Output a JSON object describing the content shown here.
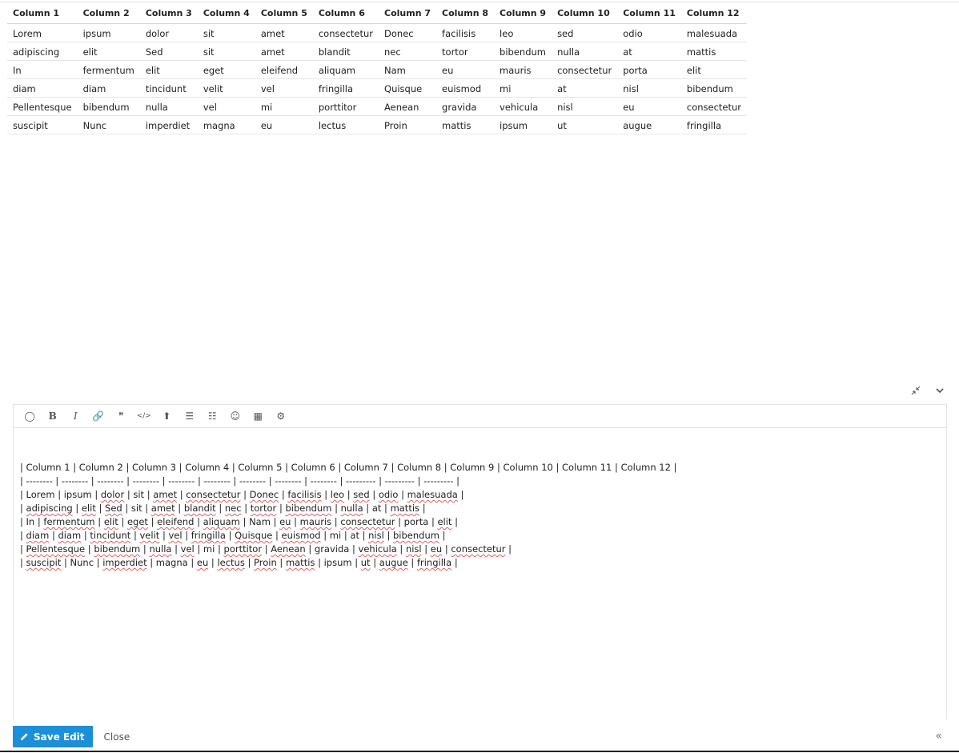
{
  "preview_table": {
    "headers": [
      "Column 1",
      "Column 2",
      "Column 3",
      "Column 4",
      "Column 5",
      "Column 6",
      "Column 7",
      "Column 8",
      "Column 9",
      "Column 10",
      "Column 11",
      "Column 12"
    ],
    "rows": [
      [
        "Lorem",
        "ipsum",
        "dolor",
        "sit",
        "amet",
        "consectetur",
        "Donec",
        "facilisis",
        "leo",
        "sed",
        "odio",
        "malesuada"
      ],
      [
        "adipiscing",
        "elit",
        "Sed",
        "sit",
        "amet",
        "blandit",
        "nec",
        "tortor",
        "bibendum",
        "nulla",
        "at",
        "mattis"
      ],
      [
        "In",
        "fermentum",
        "elit",
        "eget",
        "eleifend",
        "aliquam",
        "Nam",
        "eu",
        "mauris",
        "consectetur",
        "porta",
        "elit"
      ],
      [
        "diam",
        "diam",
        "tincidunt",
        "velit",
        "vel",
        "fringilla",
        "Quisque",
        "euismod",
        "mi",
        "at",
        "nisl",
        "bibendum"
      ],
      [
        "Pellentesque",
        "bibendum",
        "nulla",
        "vel",
        "mi",
        "porttitor",
        "Aenean",
        "gravida",
        "vehicula",
        "nisl",
        "eu",
        "consectetur"
      ],
      [
        "suscipit",
        "Nunc",
        "imperdiet",
        "magna",
        "eu",
        "lectus",
        "Proin",
        "mattis",
        "ipsum",
        "ut",
        "augue",
        "fringilla"
      ]
    ]
  },
  "composer": {
    "toolbar_icons": [
      "quote-bubble-icon",
      "bold-icon",
      "italic-icon",
      "link-icon",
      "blockquote-icon",
      "code-icon",
      "upload-icon",
      "bullet-list-icon",
      "numbered-list-icon",
      "emoji-icon",
      "calendar-icon",
      "gear-icon"
    ],
    "toolbar_glyphs": [
      "◯",
      "B",
      "I",
      "🔗",
      "❞",
      "</>",
      "⬆",
      "☰",
      "☷",
      "☺",
      "▦",
      "⚙"
    ],
    "source_lines": [
      "| Column 1 | Column 2 | Column 3 | Column 4 | Column 5 | Column 6 | Column 7 | Column 8 | Column 9 | Column 10 | Column 11 | Column 12 |",
      "| -------- | -------- | -------- | -------- | -------- | -------- | -------- | -------- | -------- | --------- | --------- | --------- |",
      "| Lorem | ipsum | dolor | sit | amet | consectetur | Donec | facilisis | leo | sed | odio | malesuada |",
      "| adipiscing | elit | Sed | sit | amet | blandit | nec | tortor | bibendum | nulla | at | mattis |",
      "| In | fermentum | elit | eget | eleifend | aliquam | Nam | eu | mauris | consectetur | porta | elit |",
      "| diam | diam | tincidunt | velit | vel | fringilla | Quisque | euismod | mi | at | nisl | bibendum |",
      "| Pellentesque | bibendum | nulla | vel | mi | porttitor | Aenean | gravida | vehicula | nisl | eu | consectetur |",
      "| suscipit | Nunc | imperdiet | magna | eu | lectus | Proin | mattis | ipsum | ut | augue | fringilla |"
    ],
    "misspelled": [
      "dolor",
      "amet",
      "consectetur",
      "Donec",
      "facilisis",
      "leo",
      "sed",
      "odio",
      "malesuada",
      "adipiscing",
      "elit",
      "Sed",
      "blandit",
      "nec",
      "tortor",
      "bibendum",
      "nulla",
      "mattis",
      "fermentum",
      "eget",
      "eleifend",
      "aliquam",
      "eu",
      "mauris",
      "diam",
      "tincidunt",
      "velit",
      "vel",
      "fringilla",
      "Quisque",
      "euismod",
      "nisl",
      "Pellentesque",
      "porttitor",
      "Aenean",
      "vehicula",
      "suscipit",
      "imperdiet",
      "lectus",
      "Proin",
      "ut",
      "augue"
    ]
  },
  "footer": {
    "save_label": "Save Edit",
    "close_label": "Close"
  },
  "colors": {
    "accent": "#1d8fd8",
    "spell_underline": "#e06060"
  }
}
